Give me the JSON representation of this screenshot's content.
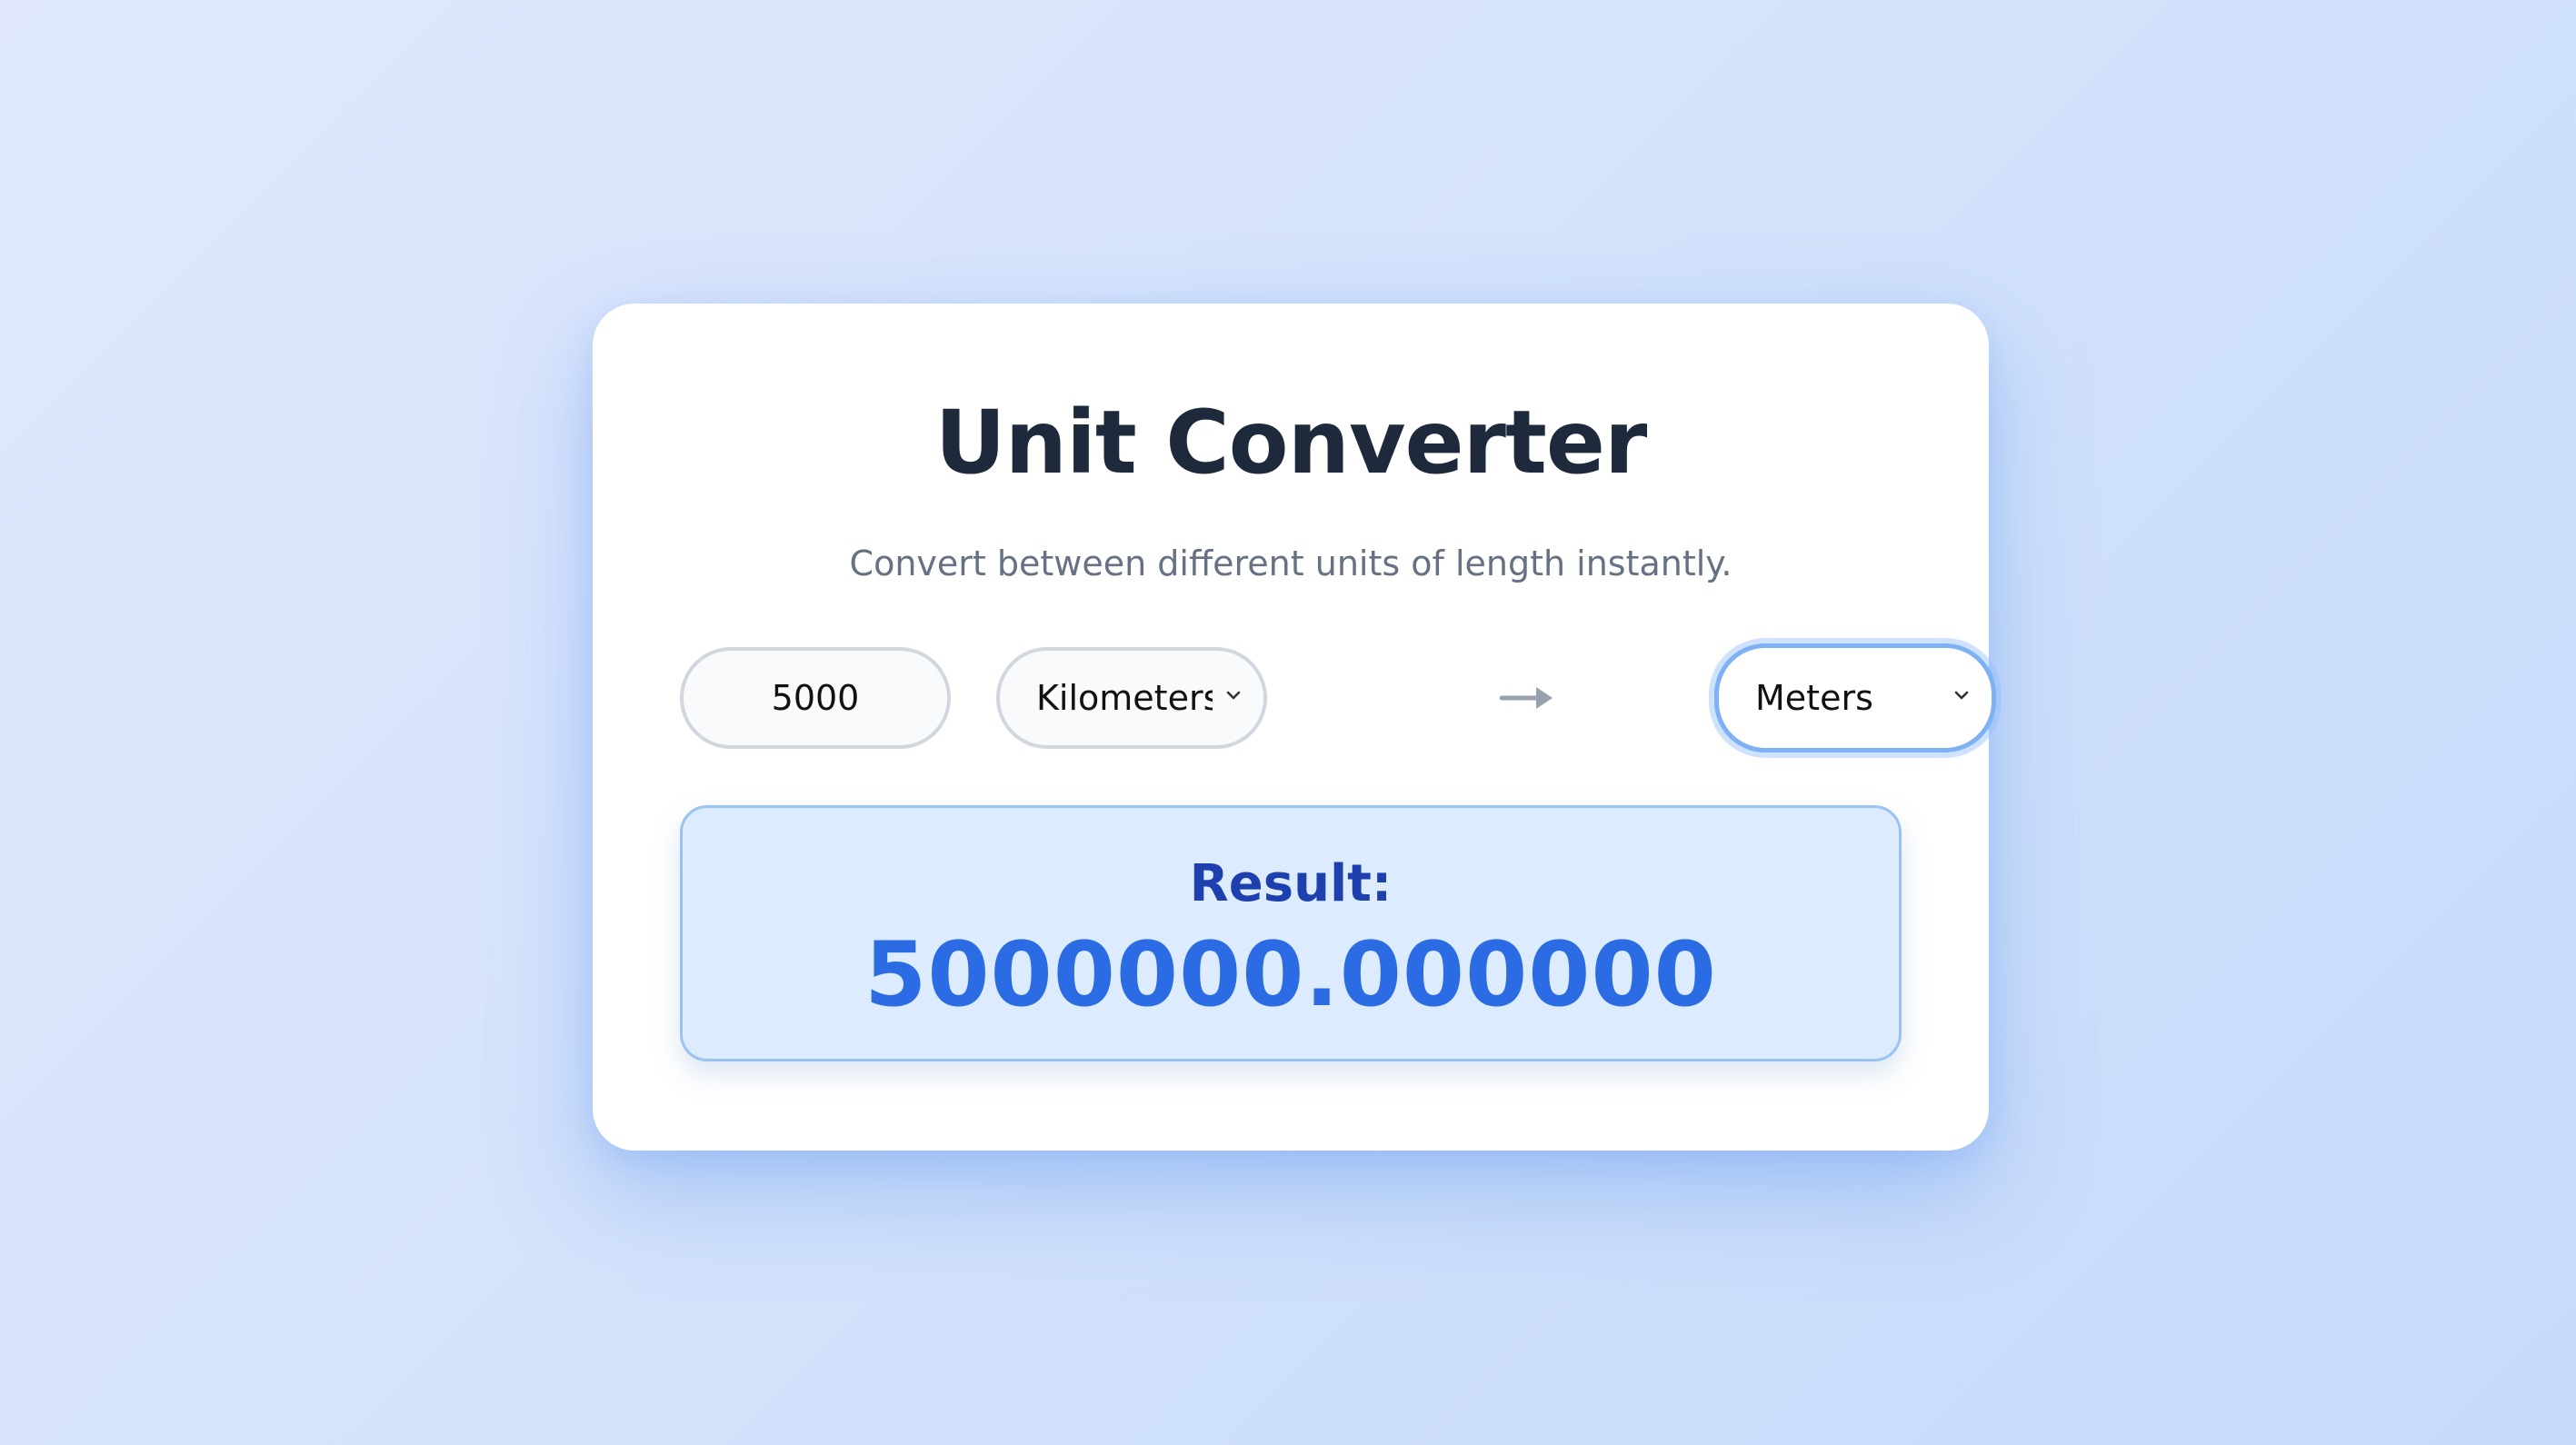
{
  "converter": {
    "title": "Unit Converter",
    "subtitle": "Convert between different units of length instantly.",
    "amount": {
      "value": "5000"
    },
    "from_unit": {
      "selected": "Kilometers",
      "icon": "chevron-down-icon"
    },
    "arrow_icon": "arrow-right-icon",
    "to_unit": {
      "selected": "Meters",
      "icon": "chevron-down-icon",
      "focused": true
    },
    "result": {
      "label": "Result:",
      "value": "5000000.000000"
    }
  },
  "colors": {
    "title": "#1e2a3b",
    "subtitle": "#667184",
    "result_label": "#1e40af",
    "result_value": "#2b6ce4",
    "result_background": "#dcebfd",
    "focus_ring": "#7fb1f5"
  }
}
